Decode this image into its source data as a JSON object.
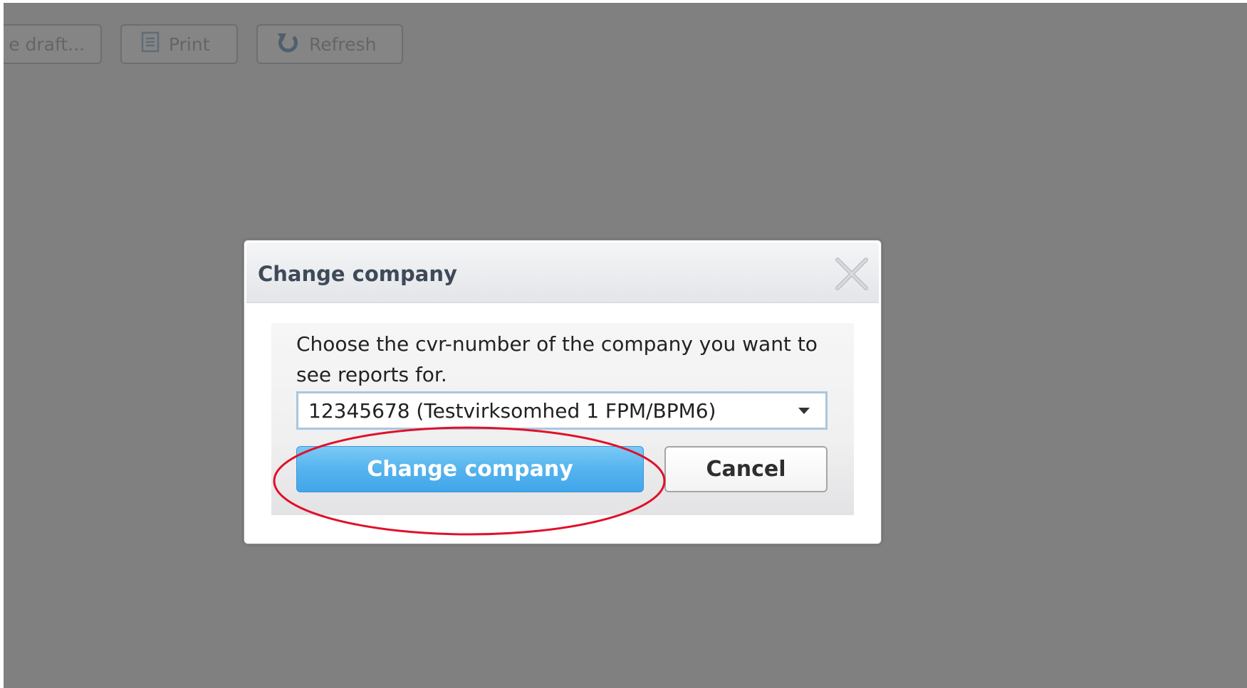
{
  "toolbar": {
    "draft_label": "e draft...",
    "print_label": "Print",
    "refresh_label": "Refresh"
  },
  "dialog": {
    "title": "Change company",
    "close_icon": "close-icon",
    "prompt": "Choose the cvr-number of the company you want to see reports for.",
    "company_select": {
      "selected": "12345678 (Testvirksomhed 1 FPM/BPM6)"
    },
    "primary_button": "Change company",
    "cancel_button": "Cancel"
  },
  "colors": {
    "overlay": "#808080",
    "primary_button": "#55b3ee",
    "highlight": "#e0102a",
    "title_text": "#3e4a59"
  }
}
